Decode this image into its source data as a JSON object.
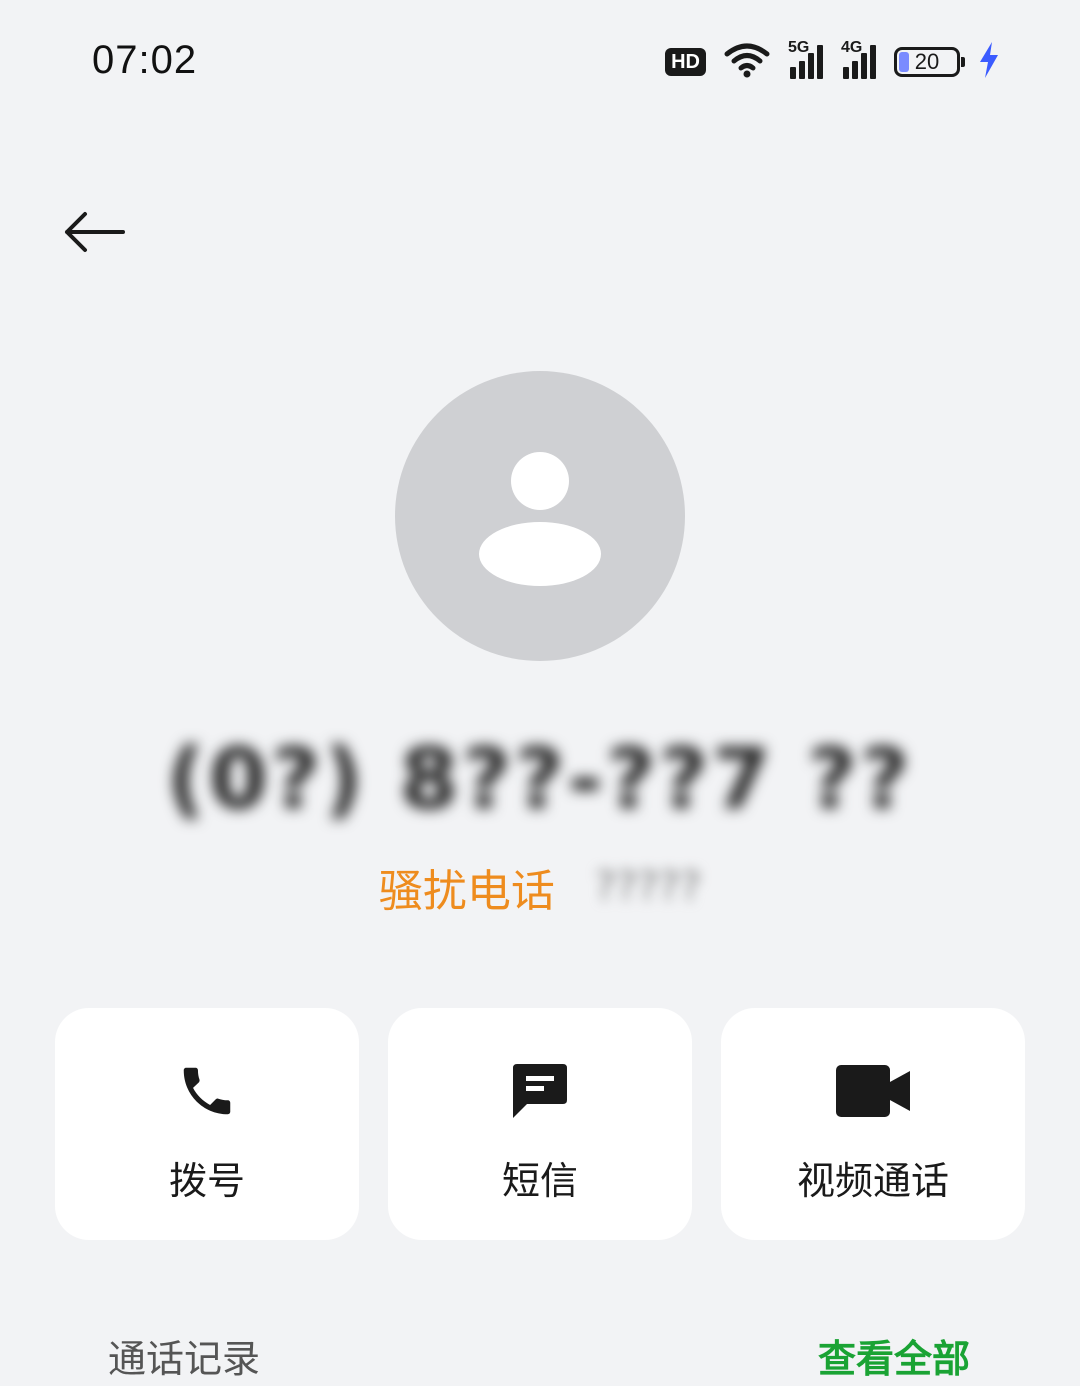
{
  "status_bar": {
    "time": "07:02",
    "hd_label": "HD",
    "network_5g": "5G",
    "network_4g": "4G",
    "battery_level": "20",
    "accent_battery": "#7a8bff",
    "charging_color": "#3b5bff"
  },
  "contact": {
    "phone_number": "(0?) 8??-??7 ??",
    "tag": "骚扰电话",
    "location": "?????",
    "tag_color": "#ee8c1e"
  },
  "actions": [
    {
      "label": "拨号",
      "icon": "phone-icon"
    },
    {
      "label": "短信",
      "icon": "message-icon"
    },
    {
      "label": "视频通话",
      "icon": "video-camera-icon"
    }
  ],
  "call_log": {
    "title": "通话记录",
    "view_all": "查看全部",
    "view_all_color": "#1aa334"
  }
}
